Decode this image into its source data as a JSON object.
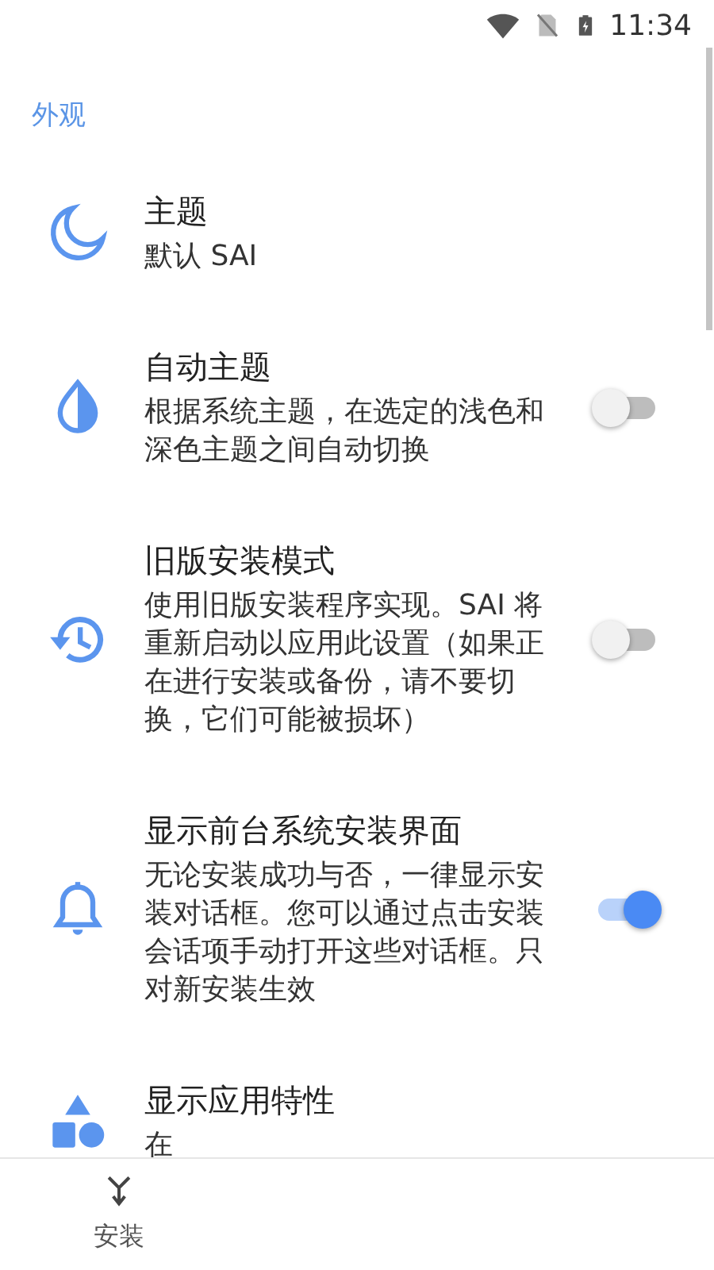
{
  "status_bar": {
    "time": "11:34"
  },
  "section": {
    "title": "外观"
  },
  "items": [
    {
      "kind": "plain",
      "title": "主题",
      "subtitle": "默认 SAI"
    },
    {
      "kind": "toggle",
      "title": "自动主题",
      "subtitle": "根据系统主题，在选定的浅色和深色主题之间自动切换",
      "on": false
    },
    {
      "kind": "toggle",
      "title": "旧版安装模式",
      "subtitle": "使用旧版安装程序实现。SAI 将重新启动以应用此设置（如果正在进行安装或备份，请不要切换，它们可能被损坏）",
      "on": false
    },
    {
      "kind": "toggle",
      "title": "显示前台系统安装界面",
      "subtitle": "无论安装成功与否，一律显示安装对话框。您可以通过点击安装会话项手动打开这些对话框。只对新安装生效",
      "on": true
    },
    {
      "kind": "plain",
      "title": "显示应用特性",
      "subtitle": "在"
    }
  ],
  "bottom_nav": [
    {
      "label": "安装"
    }
  ]
}
